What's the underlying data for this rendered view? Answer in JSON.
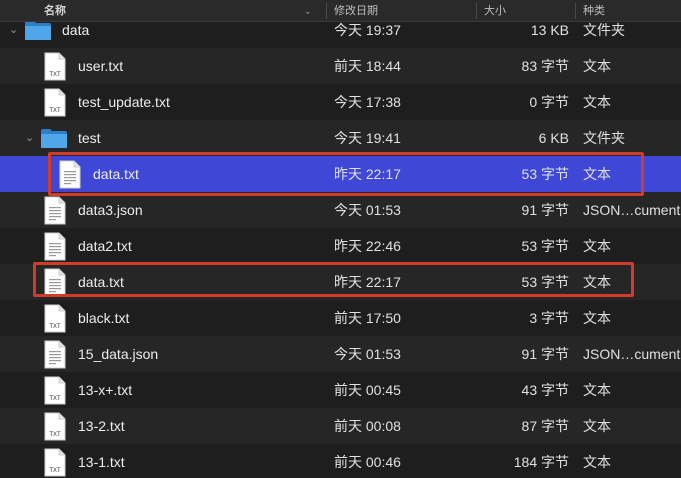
{
  "columns": {
    "name": "名称",
    "date": "修改日期",
    "size": "大小",
    "kind": "种类",
    "sort_indicator": "⌄"
  },
  "rows": [
    {
      "name": "data",
      "date": "今天 19:37",
      "size": "13 KB",
      "kind": "文件夹",
      "icon": "folder-icon",
      "expanded": true
    },
    {
      "name": "user.txt",
      "date": "前天 18:44",
      "size": "83 字节",
      "kind": "文本",
      "icon": "txt-file-icon"
    },
    {
      "name": "test_update.txt",
      "date": "今天 17:38",
      "size": "0 字节",
      "kind": "文本",
      "icon": "txt-file-icon"
    },
    {
      "name": "test",
      "date": "今天 19:41",
      "size": "6 KB",
      "kind": "文件夹",
      "icon": "folder-icon",
      "expanded": true
    },
    {
      "name": "data.txt",
      "date": "昨天 22:17",
      "size": "53 字节",
      "kind": "文本",
      "icon": "document-icon",
      "selected": true
    },
    {
      "name": "data3.json",
      "date": "今天 01:53",
      "size": "91 字节",
      "kind": "JSON…cument",
      "icon": "document-icon"
    },
    {
      "name": "data2.txt",
      "date": "昨天 22:46",
      "size": "53 字节",
      "kind": "文本",
      "icon": "document-icon"
    },
    {
      "name": "data.txt",
      "date": "昨天 22:17",
      "size": "53 字节",
      "kind": "文本",
      "icon": "document-icon"
    },
    {
      "name": "black.txt",
      "date": "前天 17:50",
      "size": "3 字节",
      "kind": "文本",
      "icon": "txt-file-icon"
    },
    {
      "name": "15_data.json",
      "date": "今天 01:53",
      "size": "91 字节",
      "kind": "JSON…cument",
      "icon": "document-icon"
    },
    {
      "name": "13-x+.txt",
      "date": "前天 00:45",
      "size": "43 字节",
      "kind": "文本",
      "icon": "txt-file-icon"
    },
    {
      "name": "13-2.txt",
      "date": "前天 00:08",
      "size": "87 字节",
      "kind": "文本",
      "icon": "txt-file-icon"
    },
    {
      "name": "13-1.txt",
      "date": "前天 00:46",
      "size": "184 字节",
      "kind": "文本",
      "icon": "txt-file-icon"
    }
  ],
  "icon_labels": {
    "txt": "TXT"
  },
  "colors": {
    "selection": "#3f47d6",
    "highlight_box": "#d13b2a",
    "folder": "#4fa6e8"
  }
}
